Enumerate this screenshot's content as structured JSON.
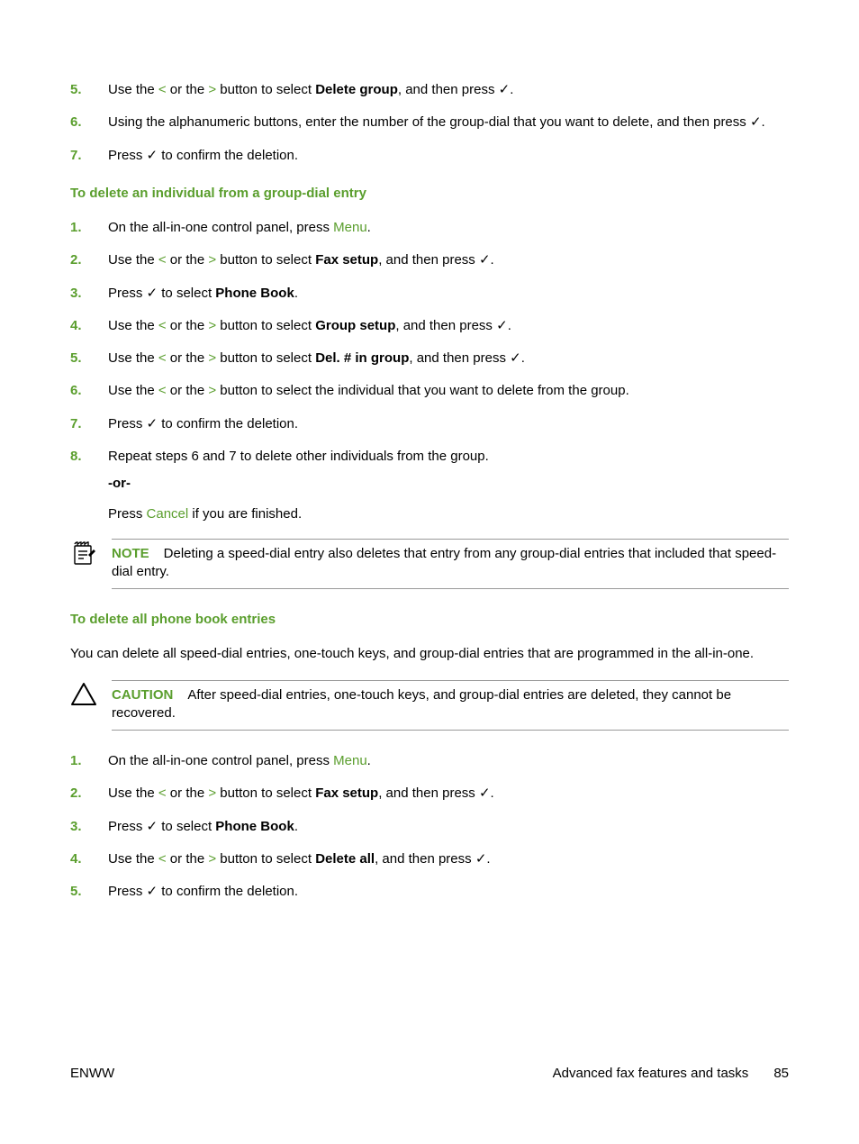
{
  "glyphs": {
    "lt": "<",
    "gt": ">",
    "check": "✓"
  },
  "ui": {
    "menu": "Menu",
    "cancel": "Cancel"
  },
  "topSteps": [
    {
      "n": "5.",
      "pre": "Use the ",
      "mid1": " or the ",
      "mid2": " button to select ",
      "bold": "Delete group",
      "post": ", and then press ",
      "tail": "."
    },
    {
      "n": "6.",
      "full1": "Using the alphanumeric buttons, enter the number of the group-dial that you want to delete, and then press ",
      "tail": "."
    },
    {
      "n": "7.",
      "pre": "Press ",
      "post": " to confirm the deletion."
    }
  ],
  "heading_a": "To delete an individual from a group-dial entry",
  "section_a": [
    {
      "n": "1.",
      "t1": "On the all-in-one control panel, press ",
      "t2": "."
    },
    {
      "n": "2.",
      "pre": "Use the ",
      "mid1": " or the ",
      "mid2": " button to select ",
      "bold": "Fax setup",
      "post": ", and then press ",
      "tail": "."
    },
    {
      "n": "3.",
      "pre": "Press ",
      "mid": " to select ",
      "bold": "Phone Book",
      "tail": "."
    },
    {
      "n": "4.",
      "pre": "Use the ",
      "mid1": " or the ",
      "mid2": " button to select ",
      "bold": "Group setup",
      "post": ", and then press ",
      "tail": "."
    },
    {
      "n": "5.",
      "pre": "Use the ",
      "mid1": " or the ",
      "mid2": " button to select ",
      "bold": "Del. # in group",
      "post": ", and then press ",
      "tail": "."
    },
    {
      "n": "6.",
      "pre": "Use the ",
      "mid1": " or the ",
      "mid2": " button to select the individual that you want to delete from the group."
    },
    {
      "n": "7.",
      "pre": "Press ",
      "post": " to confirm the deletion."
    },
    {
      "n": "8.",
      "full": "Repeat steps 6 and 7 to delete other individuals from the group."
    }
  ],
  "or": "-or-",
  "press_cancel_pre": "Press ",
  "press_cancel_post": " if you are finished.",
  "note_label": "NOTE",
  "note_body": "Deleting a speed-dial entry also deletes that entry from any group-dial entries that included that speed-dial entry.",
  "heading_b": "To delete all phone book entries",
  "intro_b": "You can delete all speed-dial entries, one-touch keys, and group-dial entries that are programmed in the all-in-one.",
  "caution_label": "CAUTION",
  "caution_body": "After speed-dial entries, one-touch keys, and group-dial entries are deleted, they cannot be recovered.",
  "section_b": [
    {
      "n": "1.",
      "t1": "On the all-in-one control panel, press ",
      "t2": "."
    },
    {
      "n": "2.",
      "pre": "Use the ",
      "mid1": " or the ",
      "mid2": " button to select ",
      "bold": "Fax setup",
      "post": ", and then press ",
      "tail": "."
    },
    {
      "n": "3.",
      "pre": "Press ",
      "mid": " to select ",
      "bold": "Phone Book",
      "tail": "."
    },
    {
      "n": "4.",
      "pre": "Use the ",
      "mid1": " or the ",
      "mid2": " button to select ",
      "bold": "Delete all",
      "post": ", and then press ",
      "tail": "."
    },
    {
      "n": "5.",
      "pre": "Press ",
      "post": " to confirm the deletion."
    }
  ],
  "footer": {
    "left": "ENWW",
    "center": "Advanced fax features and tasks",
    "page": "85"
  }
}
